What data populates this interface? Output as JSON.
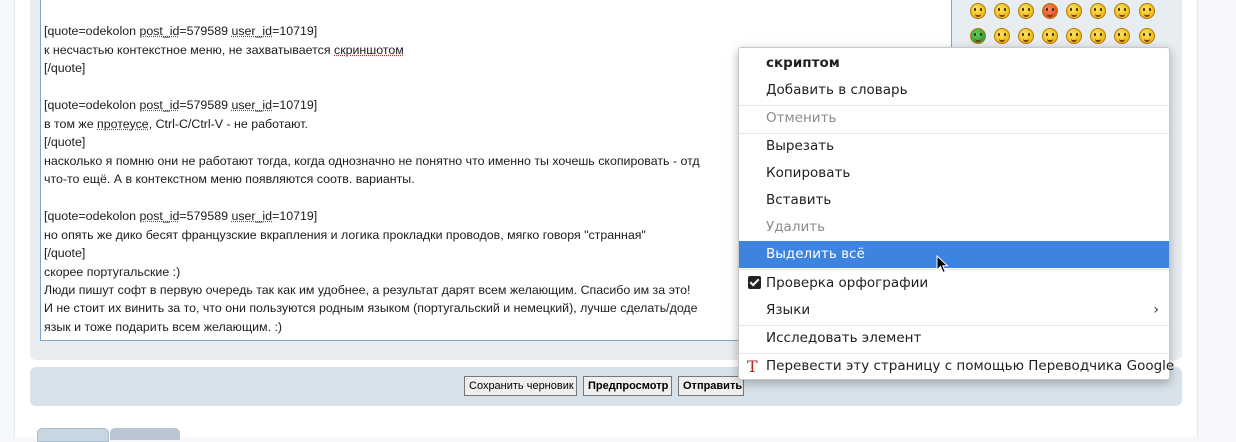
{
  "editor": {
    "lines": [
      "[quote=odekolon post_id=579589 user_id=10719]",
      "к несчастью контекстное меню, не захватывается скриншотом",
      "[/quote]",
      "",
      "[quote=odekolon post_id=579589 user_id=10719]",
      "в том же протеусе, Ctrl-C/Ctrl-V - не работают.",
      "[/quote]",
      "насколько я помню они не работают тогда, когда однозначно не понятно что именно ты хочешь скопировать - отд",
      "что-то ещё. А в контекстном меню появляются соотв. варианты.",
      "",
      "[quote=odekolon post_id=579589 user_id=10719]",
      "но опять же дико бесят французские вкрапления и логика прокладки проводов, мягко говоря \"странная\"",
      "[/quote]",
      "скорее португальские :)",
      "Люди пишут софт в первую очередь так как им удобнее, а результат дарят всем желающим. Спасибо им за это!",
      "И не стоит их винить за то, что они пользуются родным языком (португальский и немецкий), лучше сделать/доде",
      "язык и тоже подарить всем желающим. :)"
    ]
  },
  "smileys": [
    {
      "name": "smiley-icon",
      "color": "yellow"
    },
    {
      "name": "smiley-icon",
      "color": "yellow"
    },
    {
      "name": "smiley-icon",
      "color": "yellow"
    },
    {
      "name": "smiley-angry-icon",
      "color": "red"
    },
    {
      "name": "smiley-icon",
      "color": "yellow"
    },
    {
      "name": "smiley-devil-icon",
      "color": "yellow"
    },
    {
      "name": "smiley-devil-icon",
      "color": "yellow"
    },
    {
      "name": "smiley-icon",
      "color": "yellow"
    },
    {
      "name": "smiley-sick-icon",
      "color": "green"
    },
    {
      "name": "smiley-glasses-icon",
      "color": "yellow"
    },
    {
      "name": "smiley-icon",
      "color": "yellow"
    },
    {
      "name": "smiley-icon",
      "color": "yellow"
    },
    {
      "name": "smiley-icon",
      "color": "yellow"
    },
    {
      "name": "smiley-icon",
      "color": "yellow"
    },
    {
      "name": "smiley-headphones-icon",
      "color": "yellow"
    },
    {
      "name": "smiley-icon",
      "color": "yellow"
    }
  ],
  "buttons": {
    "save_draft": "Сохранить черновик",
    "preview": "Предпросмотр",
    "submit": "Отправить"
  },
  "context_menu": {
    "suggestion": "скриптом",
    "add_to_dictionary": "Добавить в словарь",
    "undo": "Отменить",
    "cut": "Вырезать",
    "copy": "Копировать",
    "paste": "Вставить",
    "delete": "Удалить",
    "select_all": "Выделить всё",
    "spell_check": "Проверка орфографии",
    "languages": "Языки",
    "inspect": "Исследовать элемент",
    "translate": "Перевести эту страницу с помощью Переводчика Google",
    "highlight_color": "#3c84df"
  }
}
